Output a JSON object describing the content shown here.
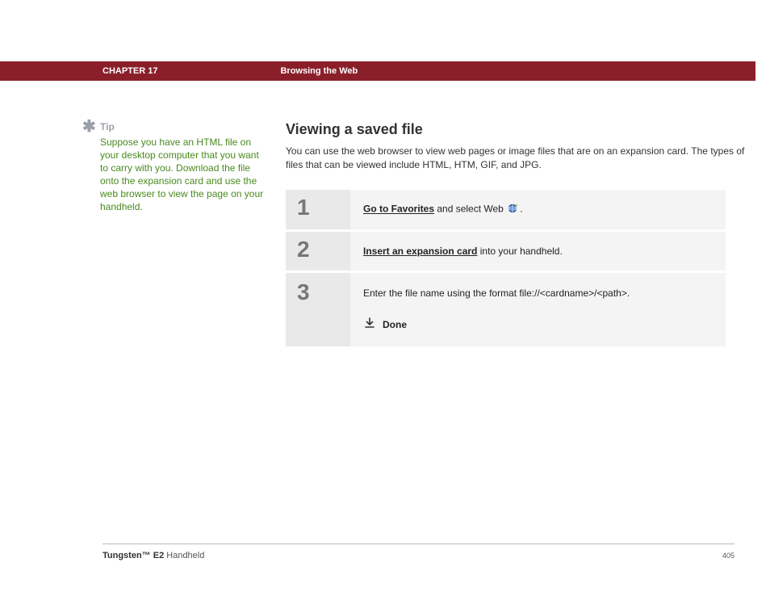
{
  "header": {
    "chapter": "CHAPTER 17",
    "topic": "Browsing the Web"
  },
  "tip": {
    "heading": "Tip",
    "body": "Suppose you have an HTML file on your desktop computer that you want to carry with you. Download the file onto the expansion card and use the web browser to view the page on your handheld."
  },
  "section": {
    "title": "Viewing a saved file",
    "intro": "You can use the web browser to view web pages or image files that are on an expansion card. The types of files that can be viewed include HTML, HTM, GIF, and JPG."
  },
  "steps": [
    {
      "num": "1",
      "link": "Go to Favorites",
      "rest": " and select Web ",
      "tail": "."
    },
    {
      "num": "2",
      "link": "Insert an expansion card",
      "rest": " into your handheld.",
      "tail": ""
    },
    {
      "num": "3",
      "text": "Enter the file name using the format file://<cardname>/<path>.",
      "done": "Done"
    }
  ],
  "footer": {
    "product_bold": "Tungsten™ E2",
    "product_rest": " Handheld",
    "page": "405"
  }
}
